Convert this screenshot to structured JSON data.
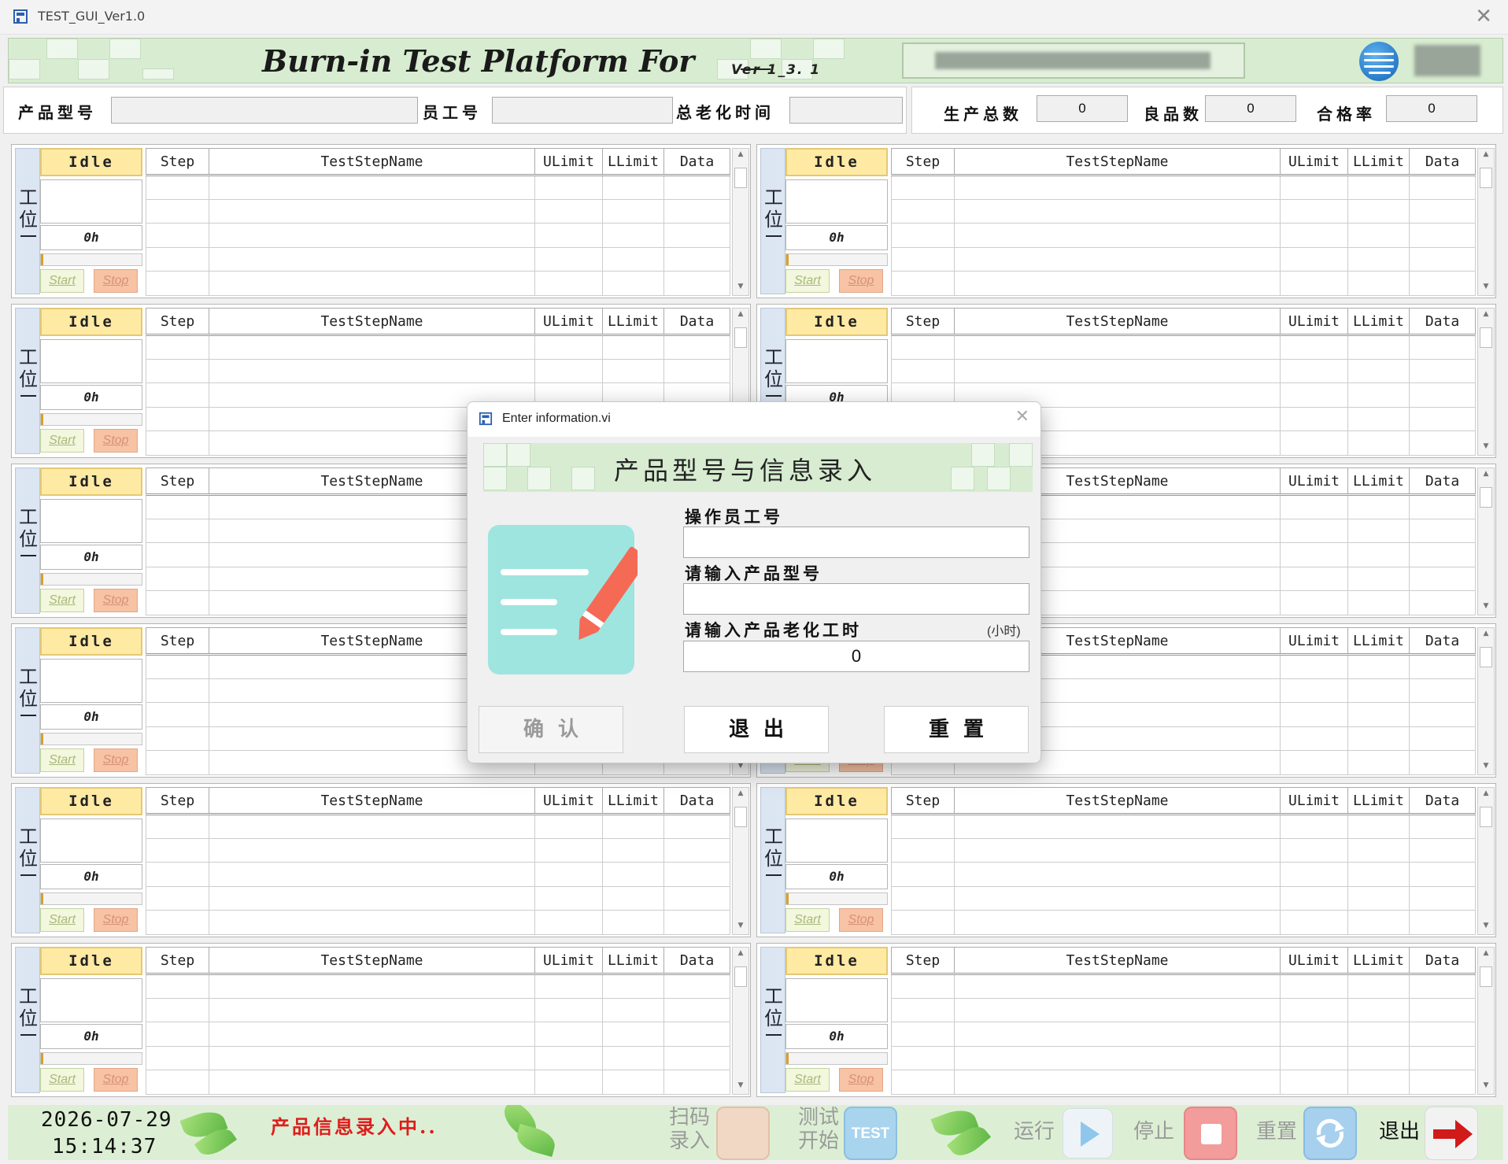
{
  "window": {
    "title": "TEST_GUI_Ver1.0",
    "close_glyph": "✕"
  },
  "header": {
    "title": "Burn-in Test Platform For",
    "version": "Ver 1_3. 1"
  },
  "info_bar": {
    "product_model_label": "产品型号",
    "product_model_value": "",
    "employee_id_label": "员工号",
    "employee_id_value": "",
    "total_aging_time_label": "总老化时间",
    "total_aging_time_value": "",
    "production_total_label": "生产总数",
    "production_total_value": "0",
    "good_count_label": "良品数",
    "good_count_value": "0",
    "pass_rate_label": "合格率",
    "pass_rate_value": "0"
  },
  "station_template": {
    "label_line1": "工",
    "label_line2": "位",
    "status": "Idle",
    "hours": "0h",
    "progress": 0.02,
    "start_label": "Start",
    "stop_label": "Stop",
    "columns": [
      "Step",
      "TestStepName",
      "ULimit",
      "LLimit",
      "Data"
    ],
    "scroll_up": "▲",
    "scroll_down": "▼"
  },
  "dialog": {
    "title": "Enter information.vi",
    "close_glyph": "✕",
    "banner": "产品型号与信息录入",
    "operator_id_label": "操作员工号",
    "operator_id_value": "",
    "model_label": "请输入产品型号",
    "model_value": "",
    "aging_hours_label": "请输入产品老化工时",
    "aging_hours_unit": "(小时)",
    "aging_hours_value": "0",
    "confirm": "确认",
    "exit": "退出",
    "reset": "重置"
  },
  "footer": {
    "date": "2026-07-29",
    "time": "15:14:37",
    "status_message": "产品信息录入中..",
    "scan_label_1": "扫码",
    "scan_label_2": "录入",
    "test_label_1": "测试",
    "test_label_2": "开始",
    "test_icon_text": "TEST",
    "run_label": "运行",
    "stop_label": "停止",
    "reset_label": "重置",
    "exit_label": "退出"
  },
  "colors": {
    "banner_green": "#d7ecd0",
    "status_yellow": "#ffeaa4",
    "stop_orange": "#f7c3a4",
    "alert_red": "#e01b1b",
    "exit_arrow_red": "#d11a1a"
  }
}
